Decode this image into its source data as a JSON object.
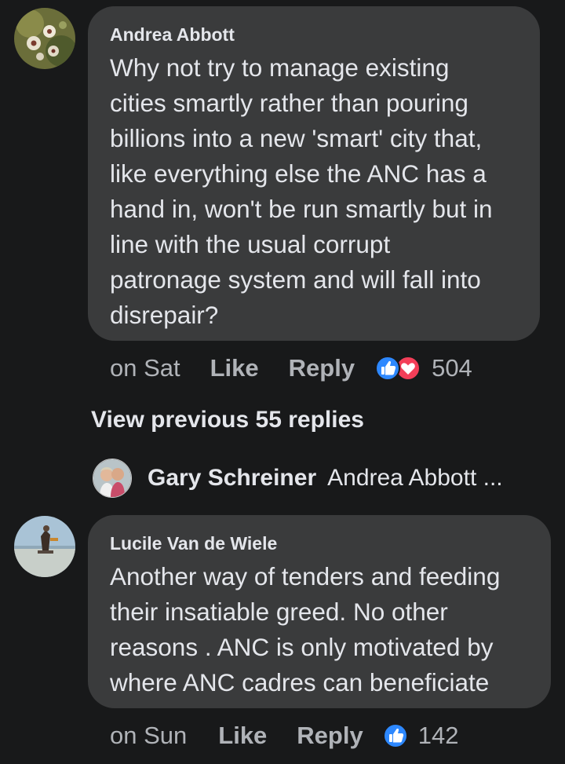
{
  "comments": [
    {
      "author": "Andrea Abbott",
      "text": "Why not try to manage existing\ncities smartly rather than pouring\nbillions into a new 'smart' city that,\nlike everything else the ANC has a\nhand in, won't be run smartly but in\nline with the usual corrupt\npatronage system and will fall into\ndisrepair?",
      "time": "on Sat",
      "like_label": "Like",
      "reply_label": "Reply",
      "reaction_count": "504",
      "reactions": [
        "like",
        "love"
      ]
    },
    {
      "author": "Lucile Van de Wiele",
      "text": "Another way of tenders and feeding\ntheir insatiable greed. No other\nreasons . ANC is only motivated by\nwhere ANC cadres can beneficiate",
      "time": "on Sun",
      "like_label": "Like",
      "reply_label": "Reply",
      "reaction_count": "142",
      "reactions": [
        "like"
      ]
    }
  ],
  "view_previous": "View previous 55 replies",
  "latest_reply": {
    "author": "Gary Schreiner",
    "snippet": "Andrea Abbott ..."
  },
  "colors": {
    "background": "#18191a",
    "bubble": "#3a3b3c",
    "primary_text": "#e4e6eb",
    "secondary_text": "#b0b3b8",
    "like_blue": "#2d88ff",
    "love_red": "#f33e58"
  }
}
